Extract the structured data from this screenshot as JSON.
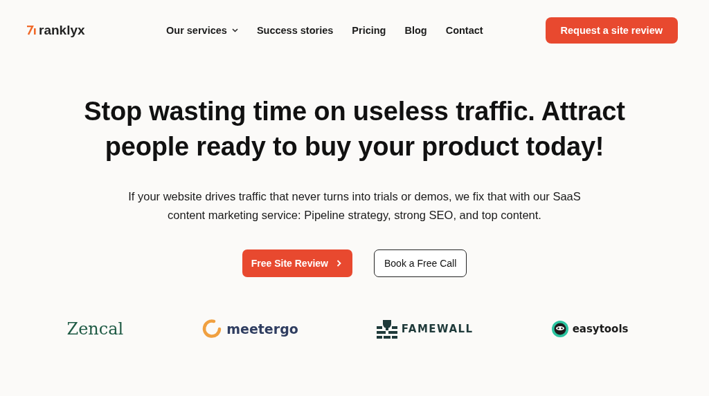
{
  "brand": "ranklyx",
  "nav": [
    {
      "label": "Our services",
      "dropdown": true
    },
    {
      "label": "Success stories",
      "dropdown": false
    },
    {
      "label": "Pricing",
      "dropdown": false
    },
    {
      "label": "Blog",
      "dropdown": false
    },
    {
      "label": "Contact",
      "dropdown": false
    }
  ],
  "cta": "Request a site review",
  "headline": "Stop wasting time on useless traffic. Attract people ready to buy your product today!",
  "subtitle": "If your website drives traffic that never turns into trials or demos, we fix that with our SaaS content marketing service: Pipeline strategy, strong SEO, and top content.",
  "buttons": [
    {
      "label": "Free Site Review",
      "kind": "primary"
    },
    {
      "label": "Book a Free Call",
      "kind": "outline"
    }
  ],
  "logos": [
    {
      "name": "Zencal",
      "kind": "serif"
    },
    {
      "name": "meetergo",
      "kind": "ring"
    },
    {
      "name": "FAMEWALL",
      "kind": "trophy"
    },
    {
      "name": "easytools",
      "kind": "badge"
    }
  ]
}
